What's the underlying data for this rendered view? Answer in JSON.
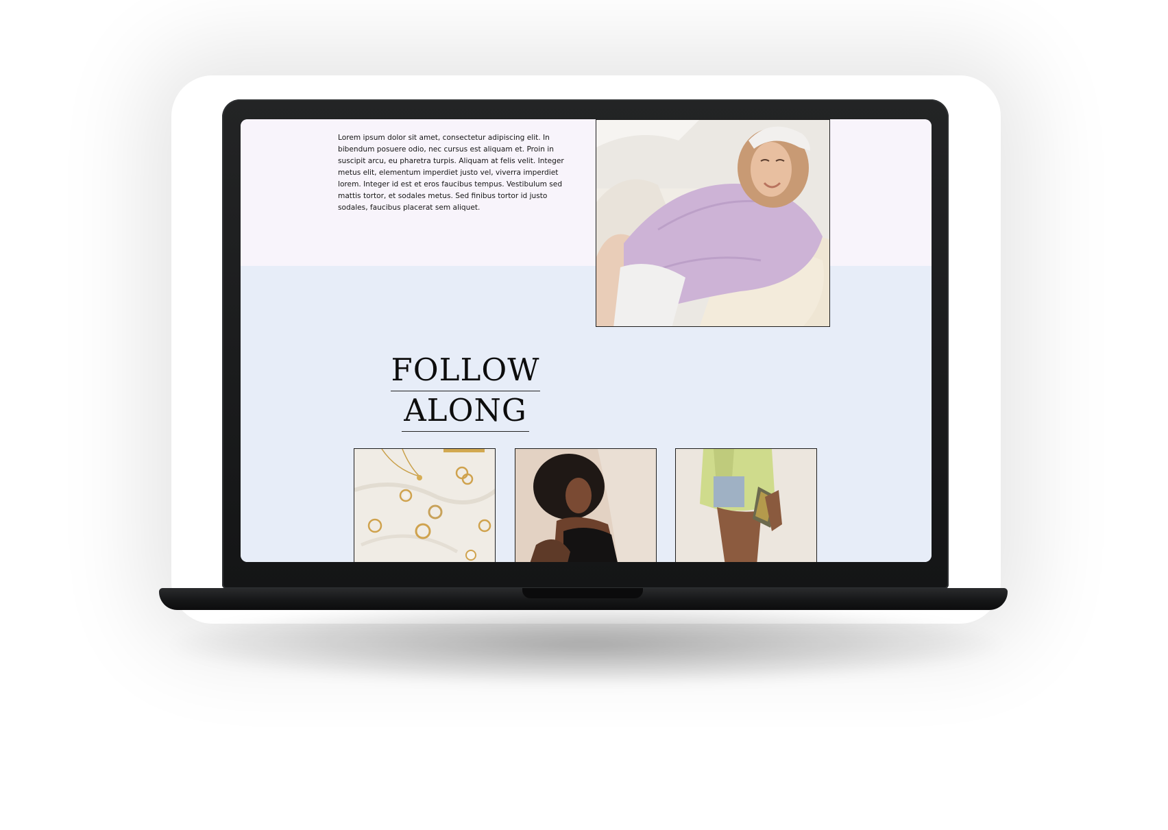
{
  "intro": {
    "text": "Lorem ipsum dolor sit amet, consectetur adipiscing elit. In bibendum posuere odio, nec cursus est aliquam et. Proin in suscipit arcu, eu pharetra turpis. Aliquam at felis velit. Integer metus elit, elementum imperdiet justo vel, viverra imperdiet lorem. Integer id est et eros faucibus tempus. Vestibulum sed mattis tortor, et sodales metus. Sed finibus tortor id justo sodales, faucibus placerat sem aliquet."
  },
  "follow": {
    "line1": "FOLLOW",
    "line2": "ALONG"
  },
  "colors": {
    "top_band": "#f8f4fb",
    "bottom_band": "#e7edf8",
    "text": "#141414",
    "device": "#141516"
  }
}
